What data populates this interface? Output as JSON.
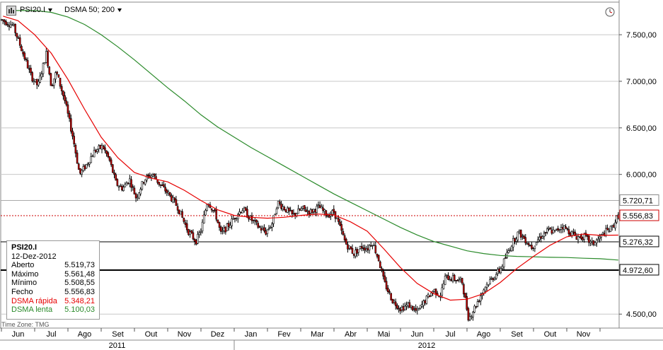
{
  "toolbar": {
    "symbol": "PSI20.I",
    "indicator": "DSMA 50; 200",
    "app_icon": "chart-app-icon",
    "clock_icon": "clock-icon"
  },
  "colors": {
    "up_candle": "#ffffff",
    "down_candle": "#cc0000",
    "candle_border": "#000000",
    "fast_ma": "#e60000",
    "slow_ma": "#2a8a2a",
    "grid": "#c8c8c8"
  },
  "info_box": {
    "title": "PSI20.I",
    "date": "12-Dez-2012",
    "rows": [
      {
        "label": "Aberto",
        "value": "5.519,73",
        "color": "#000000"
      },
      {
        "label": "Máximo",
        "value": "5.561,48",
        "color": "#000000"
      },
      {
        "label": "Mínimo",
        "value": "5.508,55",
        "color": "#000000"
      },
      {
        "label": "Fecho",
        "value": "5.556,83",
        "color": "#000000"
      },
      {
        "label": "DSMA rápida",
        "value": "5.348,21",
        "color": "#e60000"
      },
      {
        "label": "DSMA lenta",
        "value": "5.100,03",
        "color": "#2a8a2a"
      }
    ]
  },
  "timezone": "Time Zone: TMG",
  "chart_data": {
    "type": "candlestick",
    "ylim": [
      4350,
      7850
    ],
    "y_ticks": [
      {
        "value": 7500,
        "label": "7.500,00"
      },
      {
        "value": 7000,
        "label": "7.000,00"
      },
      {
        "value": 6500,
        "label": "6.500,00"
      },
      {
        "value": 6000,
        "label": "6.000,00"
      },
      {
        "value": 4500,
        "label": "4.500,00"
      }
    ],
    "price_levels": [
      {
        "value": 5720.71,
        "label": "5.720,71",
        "style": "solid",
        "color": "#aaaaaa",
        "width": 1
      },
      {
        "value": 5556.83,
        "label": "5.556,83",
        "style": "dotted",
        "color": "#cc0000",
        "width": 1
      },
      {
        "value": 5276.32,
        "label": "5.276,32",
        "style": "solid",
        "color": "#000000",
        "width": 1
      },
      {
        "value": 4972.6,
        "label": "4.972,60",
        "style": "solid",
        "color": "#000000",
        "width": 2
      }
    ],
    "months": [
      {
        "label": "Jun",
        "center": 0.5
      },
      {
        "label": "Jul",
        "center": 1.5
      },
      {
        "label": "Ago",
        "center": 2.5
      },
      {
        "label": "Set",
        "center": 3.5
      },
      {
        "label": "Out",
        "center": 4.5
      },
      {
        "label": "Nov",
        "center": 5.5
      },
      {
        "label": "Dez",
        "center": 6.5
      },
      {
        "label": "Jan",
        "center": 7.5
      },
      {
        "label": "Fev",
        "center": 8.5
      },
      {
        "label": "Mar",
        "center": 9.5
      },
      {
        "label": "Abr",
        "center": 10.5
      },
      {
        "label": "Mai",
        "center": 11.5
      },
      {
        "label": "Jun",
        "center": 12.5
      },
      {
        "label": "Jul",
        "center": 13.5
      },
      {
        "label": "Ago",
        "center": 14.5
      },
      {
        "label": "Set",
        "center": 15.5
      },
      {
        "label": "Out",
        "center": 16.5
      },
      {
        "label": "Nov",
        "center": 17.5
      }
    ],
    "years": [
      {
        "label": "2011",
        "start": 0,
        "end": 7
      },
      {
        "label": "2012",
        "start": 7,
        "end": 18.6
      }
    ],
    "price_anchors": [
      [
        0.0,
        7660
      ],
      [
        0.35,
        7600
      ],
      [
        0.6,
        7350
      ],
      [
        0.9,
        7050
      ],
      [
        1.1,
        6950
      ],
      [
        1.35,
        7300
      ],
      [
        1.5,
        6950
      ],
      [
        1.65,
        7100
      ],
      [
        1.9,
        6800
      ],
      [
        2.15,
        6400
      ],
      [
        2.35,
        6000
      ],
      [
        2.55,
        6100
      ],
      [
        2.8,
        6250
      ],
      [
        3.05,
        6300
      ],
      [
        3.25,
        6150
      ],
      [
        3.45,
        5900
      ],
      [
        3.65,
        5850
      ],
      [
        3.85,
        5950
      ],
      [
        4.05,
        5750
      ],
      [
        4.3,
        5950
      ],
      [
        4.55,
        6000
      ],
      [
        4.75,
        5900
      ],
      [
        5.0,
        5800
      ],
      [
        5.3,
        5650
      ],
      [
        5.6,
        5400
      ],
      [
        5.85,
        5280
      ],
      [
        6.0,
        5400
      ],
      [
        6.2,
        5720
      ],
      [
        6.45,
        5560
      ],
      [
        6.6,
        5360
      ],
      [
        6.85,
        5460
      ],
      [
        7.05,
        5560
      ],
      [
        7.25,
        5630
      ],
      [
        7.5,
        5520
      ],
      [
        7.75,
        5430
      ],
      [
        7.95,
        5380
      ],
      [
        8.15,
        5480
      ],
      [
        8.3,
        5700
      ],
      [
        8.5,
        5640
      ],
      [
        8.75,
        5560
      ],
      [
        9.05,
        5630
      ],
      [
        9.3,
        5600
      ],
      [
        9.55,
        5650
      ],
      [
        9.8,
        5560
      ],
      [
        10.0,
        5600
      ],
      [
        10.15,
        5460
      ],
      [
        10.35,
        5260
      ],
      [
        10.6,
        5150
      ],
      [
        10.85,
        5230
      ],
      [
        11.0,
        5200
      ],
      [
        11.15,
        5280
      ],
      [
        11.35,
        5080
      ],
      [
        11.5,
        4850
      ],
      [
        11.75,
        4650
      ],
      [
        12.0,
        4560
      ],
      [
        12.25,
        4600
      ],
      [
        12.5,
        4520
      ],
      [
        12.75,
        4650
      ],
      [
        13.0,
        4760
      ],
      [
        13.2,
        4700
      ],
      [
        13.35,
        4900
      ],
      [
        13.6,
        4880
      ],
      [
        13.85,
        4850
      ],
      [
        14.05,
        4450
      ],
      [
        14.3,
        4620
      ],
      [
        14.55,
        4800
      ],
      [
        14.8,
        4900
      ],
      [
        15.0,
        4980
      ],
      [
        15.15,
        5100
      ],
      [
        15.35,
        5260
      ],
      [
        15.55,
        5380
      ],
      [
        15.75,
        5300
      ],
      [
        15.95,
        5220
      ],
      [
        16.2,
        5330
      ],
      [
        16.45,
        5400
      ],
      [
        16.65,
        5380
      ],
      [
        16.85,
        5450
      ],
      [
        17.1,
        5380
      ],
      [
        17.3,
        5330
      ],
      [
        17.55,
        5330
      ],
      [
        17.75,
        5250
      ],
      [
        17.95,
        5300
      ],
      [
        18.15,
        5380
      ],
      [
        18.35,
        5420
      ],
      [
        18.55,
        5560
      ]
    ],
    "fast_ma": [
      [
        0.05,
        7700
      ],
      [
        0.5,
        7650
      ],
      [
        1.0,
        7500
      ],
      [
        1.5,
        7300
      ],
      [
        2.0,
        7020
      ],
      [
        2.5,
        6700
      ],
      [
        3.0,
        6400
      ],
      [
        3.5,
        6180
      ],
      [
        4.0,
        6020
      ],
      [
        4.5,
        5960
      ],
      [
        5.0,
        5920
      ],
      [
        5.5,
        5830
      ],
      [
        6.0,
        5720
      ],
      [
        6.5,
        5620
      ],
      [
        7.0,
        5560
      ],
      [
        7.5,
        5540
      ],
      [
        8.0,
        5530
      ],
      [
        8.5,
        5540
      ],
      [
        9.0,
        5560
      ],
      [
        9.5,
        5575
      ],
      [
        10.0,
        5565
      ],
      [
        10.5,
        5490
      ],
      [
        11.0,
        5390
      ],
      [
        11.5,
        5200
      ],
      [
        12.0,
        5000
      ],
      [
        12.5,
        4830
      ],
      [
        13.0,
        4720
      ],
      [
        13.5,
        4650
      ],
      [
        14.0,
        4660
      ],
      [
        14.5,
        4720
      ],
      [
        15.0,
        4840
      ],
      [
        15.5,
        4990
      ],
      [
        16.0,
        5120
      ],
      [
        16.5,
        5240
      ],
      [
        17.0,
        5330
      ],
      [
        17.5,
        5360
      ],
      [
        18.0,
        5345
      ],
      [
        18.55,
        5348
      ]
    ],
    "slow_ma": [
      [
        0.3,
        7760
      ],
      [
        1.0,
        7760
      ],
      [
        1.5,
        7740
      ],
      [
        2.0,
        7690
      ],
      [
        2.5,
        7610
      ],
      [
        3.0,
        7500
      ],
      [
        3.5,
        7370
      ],
      [
        4.0,
        7230
      ],
      [
        4.5,
        7080
      ],
      [
        5.0,
        6930
      ],
      [
        5.5,
        6790
      ],
      [
        6.0,
        6640
      ],
      [
        6.5,
        6510
      ],
      [
        7.0,
        6400
      ],
      [
        7.5,
        6290
      ],
      [
        8.0,
        6190
      ],
      [
        8.5,
        6090
      ],
      [
        9.0,
        5990
      ],
      [
        9.5,
        5890
      ],
      [
        10.0,
        5790
      ],
      [
        10.5,
        5700
      ],
      [
        11.0,
        5610
      ],
      [
        11.5,
        5520
      ],
      [
        12.0,
        5430
      ],
      [
        12.5,
        5350
      ],
      [
        13.0,
        5280
      ],
      [
        13.5,
        5230
      ],
      [
        14.0,
        5180
      ],
      [
        14.5,
        5150
      ],
      [
        15.0,
        5130
      ],
      [
        15.5,
        5120
      ],
      [
        16.0,
        5115
      ],
      [
        16.5,
        5110
      ],
      [
        17.0,
        5108
      ],
      [
        17.5,
        5100
      ],
      [
        18.0,
        5095
      ],
      [
        18.55,
        5080
      ]
    ]
  }
}
